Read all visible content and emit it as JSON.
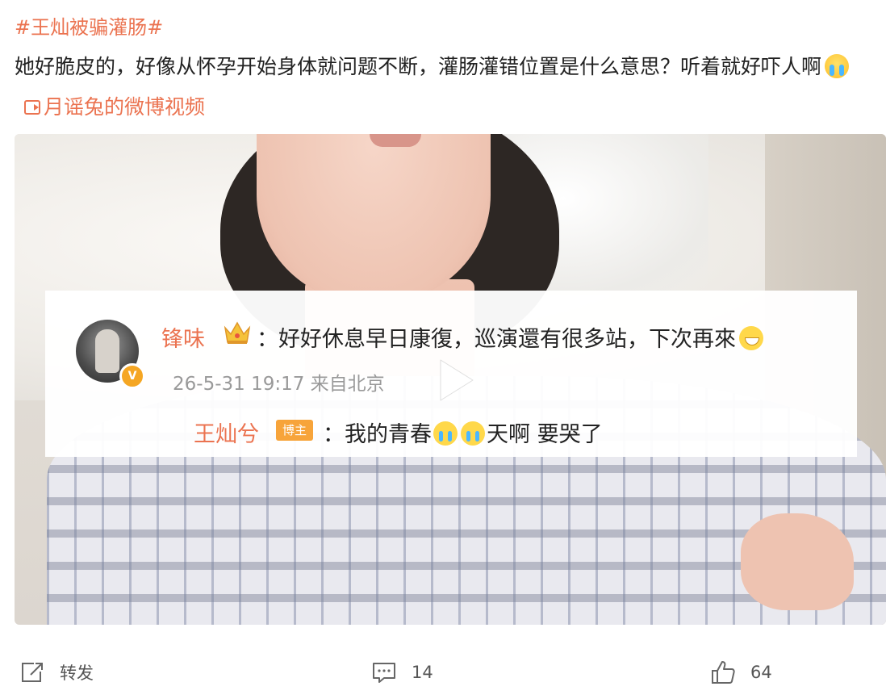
{
  "post": {
    "topic": "#王灿被骗灌肠#",
    "text_line": "她好脆皮的，好像从怀孕开始身体就问题不断，灌肠灌错位置是什么意思？听着就好吓人啊",
    "video_link": "月谣兔的微博视频"
  },
  "video_overlay": {
    "comment": {
      "username": "锋味",
      "text": "：好好休息早日康復，巡演還有很多站，下次再來",
      "time": "26-5-31 19:17",
      "location": "来自北京"
    },
    "reply": {
      "username": "王灿兮",
      "badge": "博主",
      "text_before": "：我的青春",
      "text_after": "天啊 要哭了"
    }
  },
  "footer": {
    "repost_label": "转发",
    "comment_count": "14",
    "like_count": "64"
  },
  "colors": {
    "accent": "#eb7350",
    "text": "#222222",
    "meta": "#999999",
    "badge": "#f7a43a"
  },
  "icons": [
    "crying-emoji-icon",
    "video-link-icon",
    "crown-icon",
    "smile-emoji-icon",
    "play-icon",
    "repost-icon",
    "comment-icon",
    "like-icon"
  ]
}
